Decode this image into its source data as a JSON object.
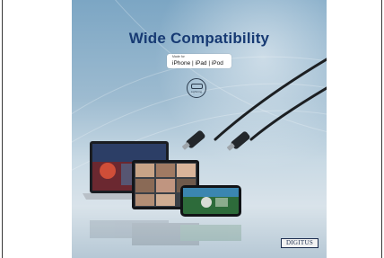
{
  "headline": "Wide Compatibility",
  "badge": {
    "made_for": "Made for",
    "apple_glyph": "",
    "devices": "iPhone | iPad | iPod"
  },
  "lightning_icon": {
    "label": "Lightning"
  },
  "brand_logo": "DIGITUS",
  "colors": {
    "headline": "#173a73",
    "background_top": "#7ca6c4",
    "background_bottom": "#d9e3ea",
    "cable": "#1c1f22"
  }
}
